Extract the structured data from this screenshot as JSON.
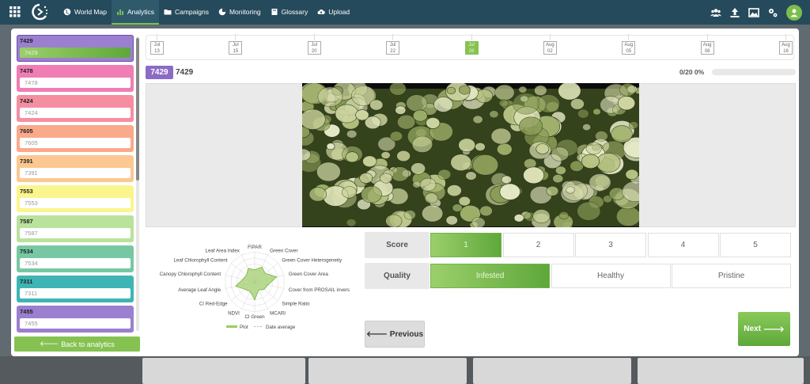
{
  "nav": {
    "items": [
      {
        "label": "World Map",
        "icon": "globe-icon",
        "active": false
      },
      {
        "label": "Analytics",
        "icon": "bar-chart-icon",
        "active": true
      },
      {
        "label": "Campaigns",
        "icon": "folder-icon",
        "active": false
      },
      {
        "label": "Monitoring",
        "icon": "pie-chart-icon",
        "active": false
      },
      {
        "label": "Glossary",
        "icon": "book-icon",
        "active": false
      },
      {
        "label": "Upload",
        "icon": "cloud-upload-icon",
        "active": false
      }
    ],
    "right_icons": [
      "users-icon",
      "upload-icon",
      "image-icon",
      "settings-icon",
      "user-avatar-icon"
    ]
  },
  "plots": [
    {
      "id": "7429",
      "value": "7429",
      "color": "#9b7fd0",
      "selected": true
    },
    {
      "id": "7478",
      "value": "7478",
      "color": "#f07eb4",
      "selected": false
    },
    {
      "id": "7424",
      "value": "7424",
      "color": "#f68ea1",
      "selected": false
    },
    {
      "id": "7605",
      "value": "7605",
      "color": "#fba98b",
      "selected": false
    },
    {
      "id": "7391",
      "value": "7391",
      "color": "#fcc790",
      "selected": false
    },
    {
      "id": "7553",
      "value": "7553",
      "color": "#fbf58e",
      "selected": false
    },
    {
      "id": "7587",
      "value": "7587",
      "color": "#b9e29c",
      "selected": false
    },
    {
      "id": "7534",
      "value": "7534",
      "color": "#77c8a2",
      "selected": false
    },
    {
      "id": "7311",
      "value": "7311",
      "color": "#3eb4b4",
      "selected": false
    },
    {
      "id": "7455",
      "value": "7455",
      "color": "#9b7fd0",
      "selected": false
    }
  ],
  "back_button": "Back to analytics",
  "timeline": [
    {
      "month": "Jul",
      "day": "13",
      "active": false
    },
    {
      "month": "Jul",
      "day": "15",
      "active": false
    },
    {
      "month": "Jul",
      "day": "20",
      "active": false
    },
    {
      "month": "Jul",
      "day": "22",
      "active": false
    },
    {
      "month": "Jul",
      "day": "28",
      "active": true
    },
    {
      "month": "Aug",
      "day": "02",
      "active": false
    },
    {
      "month": "Aug",
      "day": "05",
      "active": false
    },
    {
      "month": "Aug",
      "day": "08",
      "active": false
    },
    {
      "month": "Aug",
      "day": "16",
      "active": false
    }
  ],
  "current_plot": {
    "badge": "7429",
    "name": "7429"
  },
  "progress": {
    "text": "0/20 0%",
    "value": 0
  },
  "radar": {
    "labels": [
      "FIPAR",
      "Green Cover",
      "Green Cover Heterogeneity",
      "Green Cover Area",
      "Cover from PROSAIL invers",
      "Simple Ratio",
      "MCARI",
      "CI Green",
      "NDVI",
      "CI Red-Edge",
      "Average Leaf Angle",
      "Canopy Chlorophyll Content",
      "Leaf Chlorophyll Content",
      "Leaf Area Index"
    ],
    "plot_values": [
      0.4,
      0.55,
      0.45,
      0.75,
      0.45,
      0.4,
      0.3,
      0.6,
      0.35,
      0.4,
      0.65,
      0.4,
      0.35,
      0.5
    ],
    "legend": {
      "plot": "Plot",
      "average": "Date average"
    },
    "colors": {
      "plot": "#9ccc65",
      "average": "#999999"
    }
  },
  "score": {
    "label": "Score",
    "options": [
      "1",
      "2",
      "3",
      "4",
      "5"
    ],
    "selected": "1"
  },
  "quality": {
    "label": "Quality",
    "options": [
      "Infested",
      "Healthy",
      "Pristine"
    ],
    "selected": "Infested"
  },
  "buttons": {
    "previous": "Previous",
    "next": "Next"
  },
  "accent": "#86c252"
}
